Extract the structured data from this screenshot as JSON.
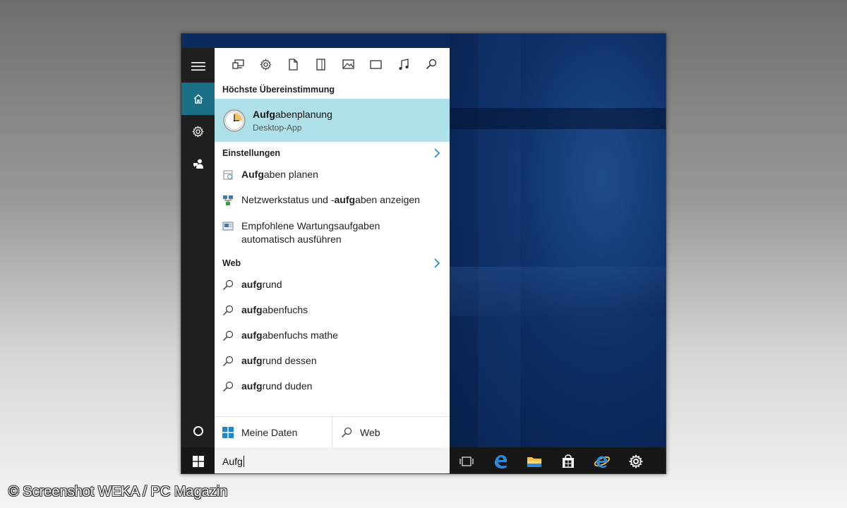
{
  "filters": [
    {
      "icon": "apps-icon"
    },
    {
      "icon": "gear-icon"
    },
    {
      "icon": "document-icon"
    },
    {
      "icon": "folder-icon"
    },
    {
      "icon": "photo-icon"
    },
    {
      "icon": "video-icon"
    },
    {
      "icon": "music-icon"
    },
    {
      "icon": "search-icon"
    }
  ],
  "rail": {
    "items": [
      {
        "icon": "hamburger-icon"
      },
      {
        "icon": "home-icon"
      },
      {
        "icon": "gear-icon"
      },
      {
        "icon": "feedback-icon"
      },
      {
        "icon": "cortana-icon"
      }
    ]
  },
  "best_match": {
    "heading": "Höchste Übereinstimmung",
    "title_bold": "Aufg",
    "title_rest": "abenplanung",
    "subtitle": "Desktop-App"
  },
  "settings": {
    "heading": "Einstellungen",
    "items": [
      {
        "bold": "Aufg",
        "rest": "aben planen",
        "icon": "task-settings-icon"
      },
      {
        "pre": "Netzwerkstatus und -",
        "bold": "aufg",
        "rest": "aben anzeigen",
        "icon": "network-icon"
      },
      {
        "line1": "Empfohlene Wartungsaufgaben",
        "line2": "automatisch ausführen",
        "icon": "maintenance-icon"
      }
    ]
  },
  "web": {
    "heading": "Web",
    "items": [
      {
        "bold": "aufg",
        "rest": "rund"
      },
      {
        "bold": "aufg",
        "rest": "abenfuchs"
      },
      {
        "bold": "aufg",
        "rest": "abenfuchs mathe"
      },
      {
        "bold": "aufg",
        "rest": "rund dessen"
      },
      {
        "bold": "aufg",
        "rest": "rund duden"
      }
    ]
  },
  "bottom_tabs": {
    "my_data": "Meine Daten",
    "web": "Web"
  },
  "search": {
    "value": "Aufg"
  },
  "taskbar": {
    "icons": [
      "task-view-icon",
      "edge-icon",
      "file-explorer-icon",
      "store-icon",
      "internet-explorer-icon",
      "settings-icon"
    ],
    "active": "settings-icon"
  },
  "watermark": "© Screenshot WEKA / PC Magazin",
  "colors": {
    "accent": "#1a6f86",
    "highlight": "#aee0ea",
    "taskbar": "#171717",
    "chevron": "#1e88c8"
  }
}
